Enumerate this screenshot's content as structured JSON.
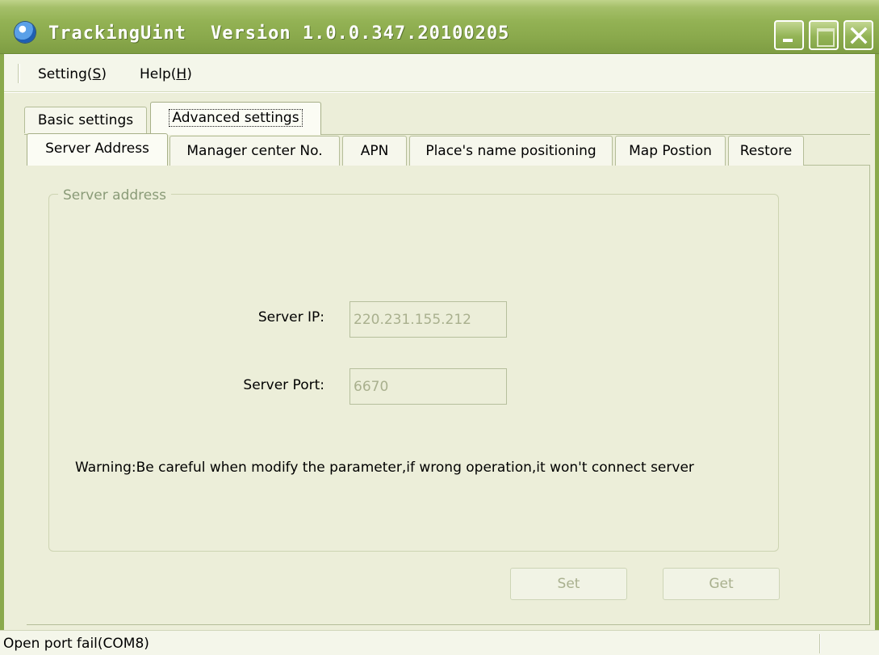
{
  "window": {
    "app_name": "TrackingUint",
    "version": "Version 1.0.0.347.20100205",
    "buttons": {
      "minimize": "minimize-icon",
      "maximize": "maximize-icon",
      "close": "close-icon"
    }
  },
  "menu": {
    "items": [
      {
        "label": "Setting(",
        "mnemonic": "S",
        "suffix": ")"
      },
      {
        "label": "Help(",
        "mnemonic": "H",
        "suffix": ")"
      }
    ]
  },
  "outer_tabs": {
    "items": [
      "Basic settings",
      "Advanced settings"
    ],
    "selected": "Advanced settings"
  },
  "inner_tabs": {
    "items": [
      "Server Address",
      "Manager center No.",
      "APN",
      "Place's name positioning",
      "Map Postion",
      "Restore"
    ],
    "selected": "Server Address"
  },
  "server_address": {
    "group_title": "Server address",
    "ip_label": "Server IP:",
    "ip_value": "220.231.155.212",
    "port_label": "Server Port:",
    "port_value": "6670",
    "warning": "Warning:Be careful when modify the parameter,if wrong operation,it won't connect server",
    "set_label": "Set",
    "get_label": "Get"
  },
  "status": {
    "text": "Open port fail(COM8)"
  },
  "colors": {
    "title_bar": "#8aa94c",
    "client_bg": "#eceed9",
    "disabled_text": "#a9b08e"
  }
}
